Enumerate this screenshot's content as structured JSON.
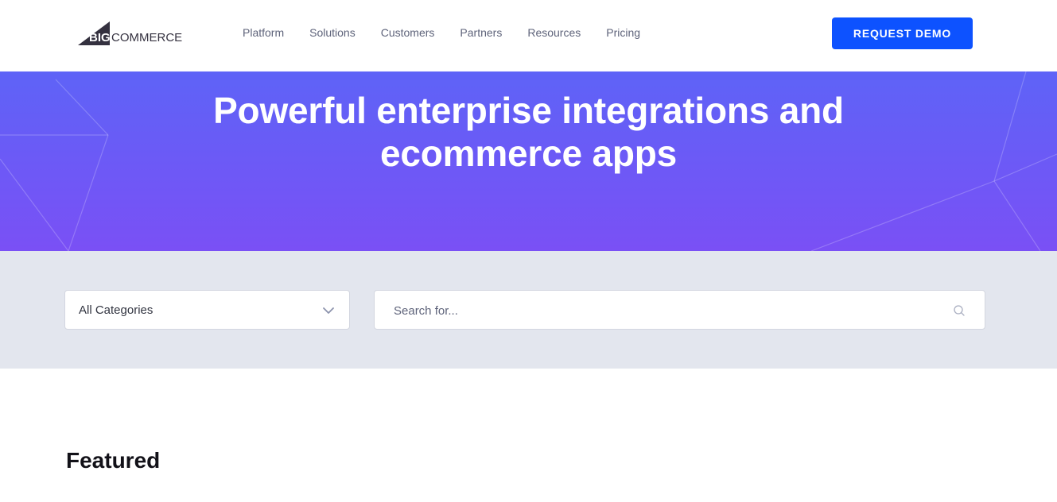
{
  "header": {
    "logo_text": "BIGCOMMERCE",
    "nav": [
      {
        "label": "Platform"
      },
      {
        "label": "Solutions"
      },
      {
        "label": "Customers"
      },
      {
        "label": "Partners"
      },
      {
        "label": "Resources"
      },
      {
        "label": "Pricing"
      }
    ],
    "cta_label": "REQUEST DEMO"
  },
  "hero": {
    "title_line1": "Powerful enterprise integrations and",
    "title_line2": "ecommerce apps"
  },
  "filters": {
    "category_value": "All Categories",
    "category_icon": "chevron-down-icon",
    "search_placeholder": "Search for...",
    "search_icon": "search-icon"
  },
  "featured": {
    "title": "Featured"
  },
  "colors": {
    "brand_blue": "#0d52ff",
    "hero_top": "#5e63f7",
    "hero_bottom": "#7a50f5",
    "filter_band": "#e3e6ee"
  }
}
